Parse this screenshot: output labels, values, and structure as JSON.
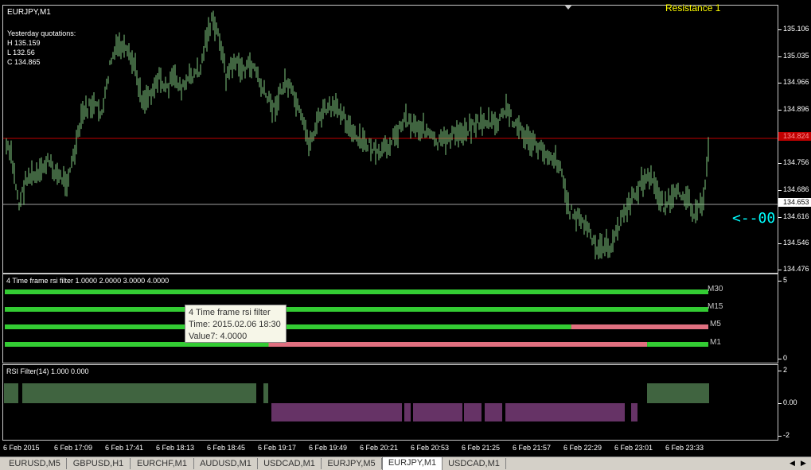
{
  "main": {
    "title": "EURJPY,M1",
    "quotes_title": "Yesterday quotations:",
    "high": "H 135.159",
    "low": "L 132.56",
    "close": "C 134.865",
    "resistance_label": "Resistance 1",
    "arrow_label": "<--00",
    "price_ticks": [
      "135.106",
      "135.035",
      "134.966",
      "134.896",
      "134.756",
      "134.686",
      "134.616",
      "134.546",
      "134.476"
    ],
    "red_line_tag": "134.824",
    "bid_tag": "134.653",
    "colors": {
      "candles": "#7fc97f",
      "red_line": "#c00000",
      "bid_line": "#a0a0a0",
      "arrow": "#00ffff"
    }
  },
  "filter": {
    "title": "4 Time frame rsi filter 1.0000 2.0000 3.0000 4.0000",
    "scale_top": "5",
    "scale_bottom": "0",
    "rows": [
      {
        "label": "M30",
        "segments": [
          {
            "from": 0,
            "to": 1,
            "color": "#33cc33"
          }
        ]
      },
      {
        "label": "M15",
        "segments": [
          {
            "from": 0,
            "to": 1,
            "color": "#33cc33"
          }
        ]
      },
      {
        "label": "M5",
        "segments": [
          {
            "from": 0,
            "to": 0.805,
            "color": "#33cc33"
          },
          {
            "from": 0.805,
            "to": 1,
            "color": "#e07080"
          }
        ]
      },
      {
        "label": "M1",
        "segments": [
          {
            "from": 0,
            "to": 0.375,
            "color": "#33cc33"
          },
          {
            "from": 0.375,
            "to": 0.913,
            "color": "#e07080"
          },
          {
            "from": 0.913,
            "to": 1,
            "color": "#33cc33"
          }
        ]
      }
    ],
    "tooltip": {
      "title": "4 Time frame rsi filter",
      "time": "Time: 2015.02.06 18:30",
      "value": "Value7: 4.0000"
    }
  },
  "rsi": {
    "title": "RSI Filter(14) 1.000 0.000",
    "scale": [
      "2",
      "0.00",
      "-2"
    ],
    "colors": {
      "up": "#7fc97f",
      "down": "#cc66cc"
    }
  },
  "time_axis": [
    "6 Feb 2015",
    "6 Feb 17:09",
    "6 Feb 17:41",
    "6 Feb 18:13",
    "6 Feb 18:45",
    "6 Feb 19:17",
    "6 Feb 19:49",
    "6 Feb 20:21",
    "6 Feb 20:53",
    "6 Feb 21:25",
    "6 Feb 21:57",
    "6 Feb 22:29",
    "6 Feb 23:01",
    "6 Feb 23:33"
  ],
  "tabs": [
    "EURUSD,M5",
    "GBPUSD,H1",
    "EURCHF,M1",
    "AUDUSD,M1",
    "USDCAD,M1",
    "EURJPY,M5",
    "EURJPY,M1",
    "USDCAD,M1"
  ],
  "active_tab": "EURJPY,M1"
}
